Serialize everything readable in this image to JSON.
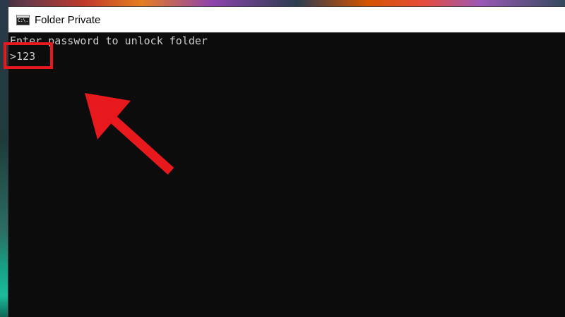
{
  "window": {
    "title": "Folder Private",
    "icon": "cmd-icon",
    "icon_text": "C:\\."
  },
  "console": {
    "prompt_line": "Enter password to unlock folder",
    "input_line": ">123"
  },
  "annotation": {
    "highlight_color": "#e8191c",
    "arrow_color": "#e8191c",
    "arrow_icon": "arrow-up-left-icon"
  }
}
